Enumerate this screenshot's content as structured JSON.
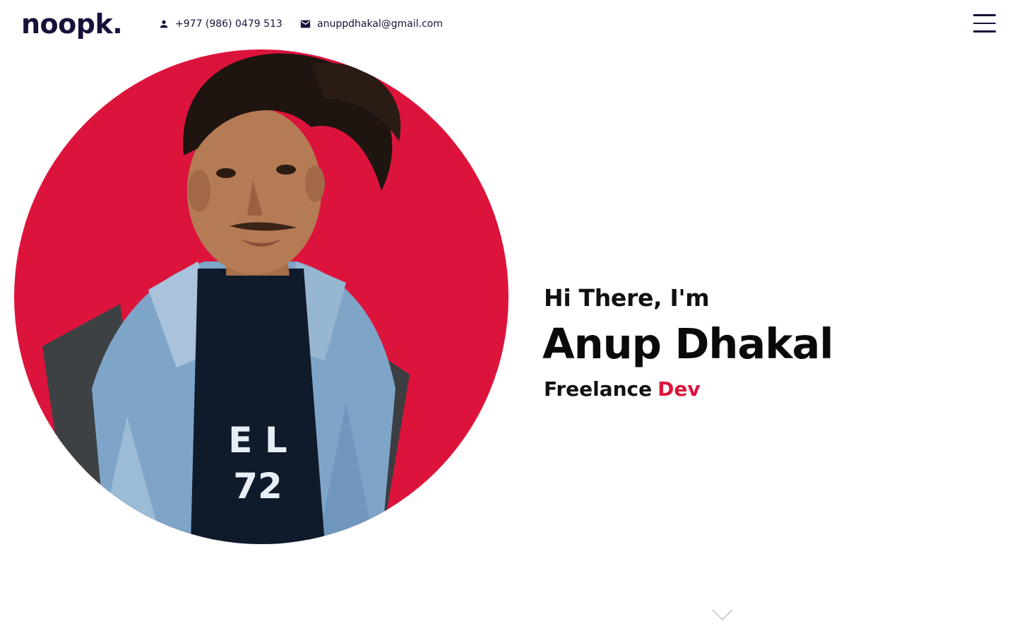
{
  "header": {
    "logo_text": "noopk.",
    "phone": "+977 (986) 0479 513",
    "email": "anuppdhakal@gmail.com",
    "menu_icon": "hamburger-icon"
  },
  "hero": {
    "greeting": "Hi There, I'm",
    "name": "Anup Dhakal",
    "role_prefix": "Freelance",
    "role_highlight": "Dev",
    "portrait_alt": "Portrait photo of Anup Dhakal",
    "scroll_icon": "chevron-down-icon"
  },
  "colors": {
    "accent": "#dc143c",
    "brand_dark": "#1b0f3a",
    "text": "#111111",
    "background": "#ffffff"
  }
}
